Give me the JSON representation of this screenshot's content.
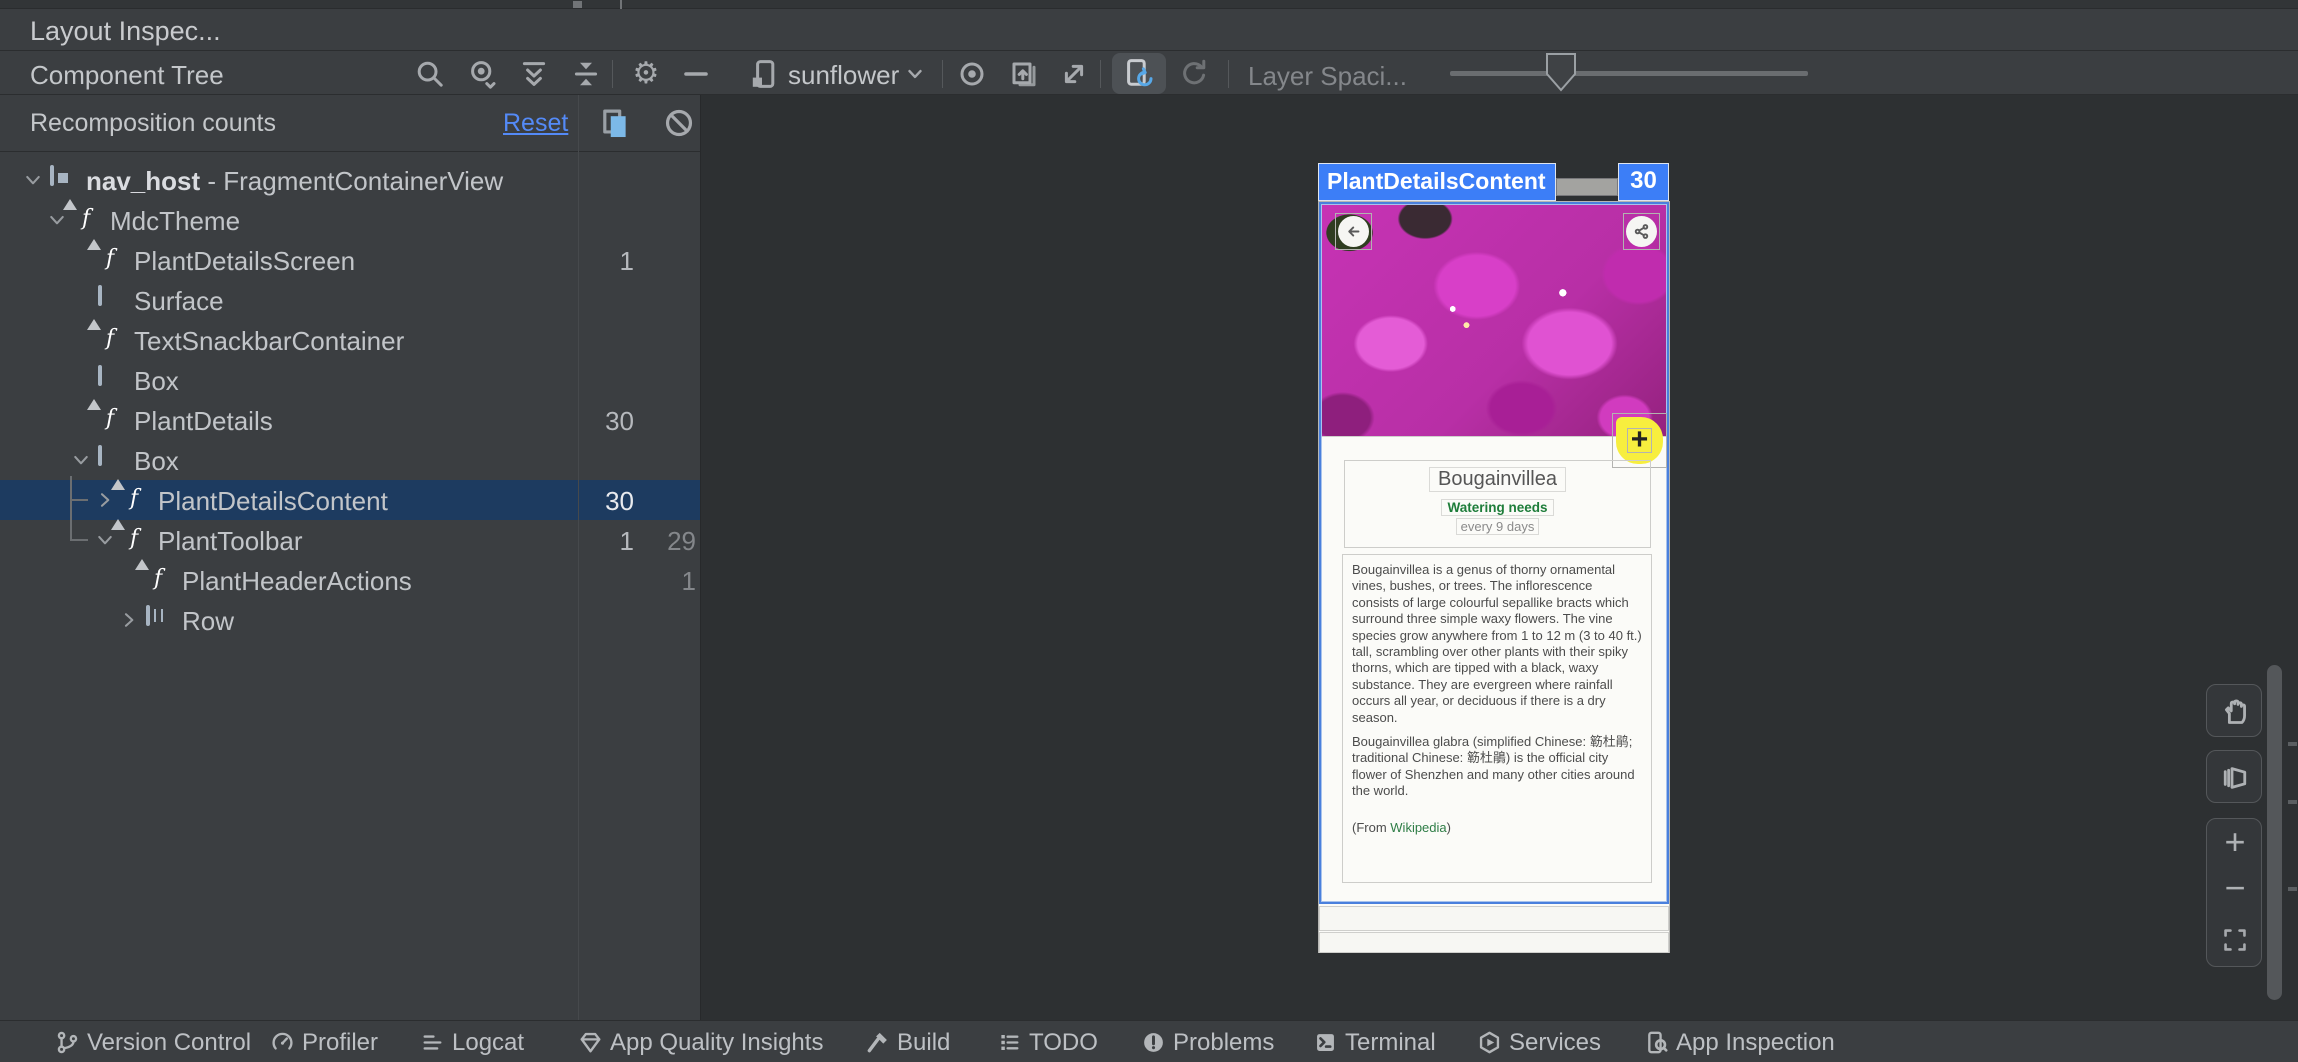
{
  "window": {
    "title": "Layout Inspec..."
  },
  "toolbar": {
    "panel_title": "Component Tree",
    "process_name": "sunflower",
    "layer_spacing_label": "Layer Spaci..."
  },
  "recomposition": {
    "label": "Recomposition counts",
    "reset_label": "Reset"
  },
  "component_tree": {
    "rows": [
      {
        "label": "nav_host",
        "suffix": " - FragmentContainerView",
        "icon": "view-host",
        "level": 0,
        "chevron": "down",
        "bold": true,
        "count": "",
        "count2": ""
      },
      {
        "label": "MdcTheme",
        "suffix": "",
        "icon": "compose",
        "level": 1,
        "chevron": "down",
        "count": "",
        "count2": ""
      },
      {
        "label": "PlantDetailsScreen",
        "suffix": "",
        "icon": "compose",
        "level": 2,
        "chevron": "",
        "count": "1",
        "count2": ""
      },
      {
        "label": "Surface",
        "suffix": "",
        "icon": "view",
        "level": 2,
        "chevron": "",
        "count": "",
        "count2": ""
      },
      {
        "label": "TextSnackbarContainer",
        "suffix": "",
        "icon": "compose",
        "level": 2,
        "chevron": "",
        "count": "",
        "count2": ""
      },
      {
        "label": "Box",
        "suffix": "",
        "icon": "view",
        "level": 2,
        "chevron": "",
        "count": "",
        "count2": ""
      },
      {
        "label": "PlantDetails",
        "suffix": "",
        "icon": "compose",
        "level": 2,
        "chevron": "",
        "count": "30",
        "count2": ""
      },
      {
        "label": "Box",
        "suffix": "",
        "icon": "view",
        "level": 2,
        "chevron": "down",
        "count": "",
        "count2": ""
      },
      {
        "label": "PlantDetailsContent",
        "suffix": "",
        "icon": "compose",
        "level": 3,
        "chevron": "right",
        "count": "30",
        "count2": "",
        "selected": true,
        "guide": "tee"
      },
      {
        "label": "PlantToolbar",
        "suffix": "",
        "icon": "compose",
        "level": 3,
        "chevron": "down",
        "count": "1",
        "count2": "29",
        "guide": "corner"
      },
      {
        "label": "PlantHeaderActions",
        "suffix": "",
        "icon": "compose",
        "level": 4,
        "chevron": "",
        "count": "",
        "count2": "1"
      },
      {
        "label": "Row",
        "suffix": "",
        "icon": "row",
        "level": 4,
        "chevron": "right",
        "count": "",
        "count2": ""
      }
    ]
  },
  "device": {
    "selected_node_label": "PlantDetailsContent",
    "recomposition_badge": "30",
    "plant_title": "Bougainvillea",
    "watering_label": "Watering needs",
    "watering_value": "every 9 days",
    "paragraph1": "Bougainvillea is a genus of thorny ornamental vines, bushes, or trees. The inflorescence consists of large colourful sepallike bracts which surround three simple waxy flowers. The vine species grow anywhere from 1 to 12 m (3 to 40 ft.) tall, scrambling over other plants with their spiky thorns, which are tipped with a black, waxy substance. They are evergreen where rainfall occurs all year, or deciduous if there is a dry season.",
    "paragraph2": "Bougainvillea glabra (simplified Chinese: 簕杜鹃; traditional Chinese: 簕杜鵑) is the official city flower of Shenzhen and many other cities around the world.",
    "source_prefix": "(From ",
    "source_link": "Wikipedia",
    "source_suffix": ")",
    "fab_label": "+"
  },
  "status_bar": {
    "items": [
      {
        "label": "Version Control",
        "icon": "branch"
      },
      {
        "label": "Profiler",
        "icon": "gauge"
      },
      {
        "label": "Logcat",
        "icon": "logcat"
      },
      {
        "label": "App Quality Insights",
        "icon": "gem"
      },
      {
        "label": "Build",
        "icon": "hammer"
      },
      {
        "label": "TODO",
        "icon": "todo"
      },
      {
        "label": "Problems",
        "icon": "problem"
      },
      {
        "label": "Terminal",
        "icon": "terminal"
      },
      {
        "label": "Services",
        "icon": "services"
      },
      {
        "label": "App Inspection",
        "icon": "inspection"
      }
    ]
  },
  "colors": {
    "accent_blue": "#3c7ef7",
    "selection_blue": "#1d3b60",
    "compose_green": "#579660",
    "fab_yellow": "#f7ee3e",
    "link_blue": "#548af7",
    "watering_green": "#1e7d3a",
    "wikipedia_green": "#2e7d46"
  }
}
